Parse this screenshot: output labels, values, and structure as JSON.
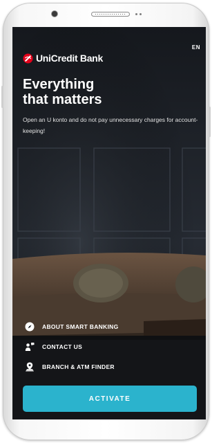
{
  "status_bar": {
    "language": "EN"
  },
  "brand": {
    "logo_text": "UniCredit Bank",
    "accent": "#e2001a"
  },
  "hero": {
    "headline_line1": "Everything",
    "headline_line2": "that matters",
    "subtitle": "Open an U konto and do not pay unnecessary charges for account-keeping!"
  },
  "menu": {
    "items": [
      {
        "label": "ABOUT SMART BANKING",
        "icon": "compass-icon"
      },
      {
        "label": "CONTACT US",
        "icon": "contact-icon"
      },
      {
        "label": "BRANCH & ATM FINDER",
        "icon": "location-pin-icon"
      }
    ]
  },
  "cta": {
    "label": "ACTIVATE",
    "color": "#2bb3cd"
  }
}
